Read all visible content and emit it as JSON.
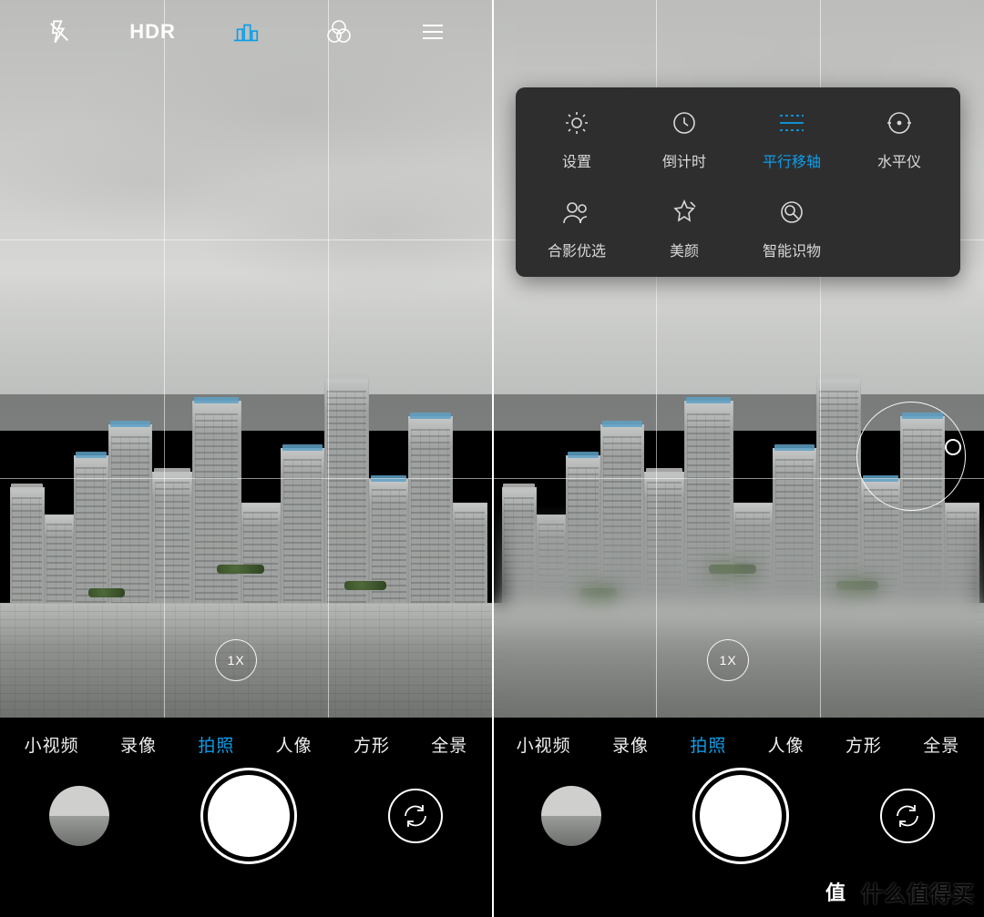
{
  "accent": "#0f9de8",
  "topbar": {
    "flash": "flash-off",
    "hdr_label": "HDR",
    "tilt_shift": "tilt-shift",
    "filters": "filters",
    "menu": "menu"
  },
  "zoom_label": "1X",
  "modes": [
    {
      "key": "short_video",
      "label": "小视频",
      "active": false
    },
    {
      "key": "record",
      "label": "录像",
      "active": false
    },
    {
      "key": "photo",
      "label": "拍照",
      "active": true
    },
    {
      "key": "portrait",
      "label": "人像",
      "active": false
    },
    {
      "key": "square",
      "label": "方形",
      "active": false
    },
    {
      "key": "pano",
      "label": "全景",
      "active": false
    }
  ],
  "menu": [
    {
      "key": "settings",
      "label": "设置",
      "active": false
    },
    {
      "key": "timer",
      "label": "倒计时",
      "active": false
    },
    {
      "key": "tilt",
      "label": "平行移轴",
      "active": true
    },
    {
      "key": "level",
      "label": "水平仪",
      "active": false
    },
    {
      "key": "group",
      "label": "合影优选",
      "active": false
    },
    {
      "key": "beauty",
      "label": "美颜",
      "active": false
    },
    {
      "key": "ai",
      "label": "智能识物",
      "active": false
    }
  ],
  "watermark": {
    "badge": "值",
    "text": "什么值得买"
  }
}
